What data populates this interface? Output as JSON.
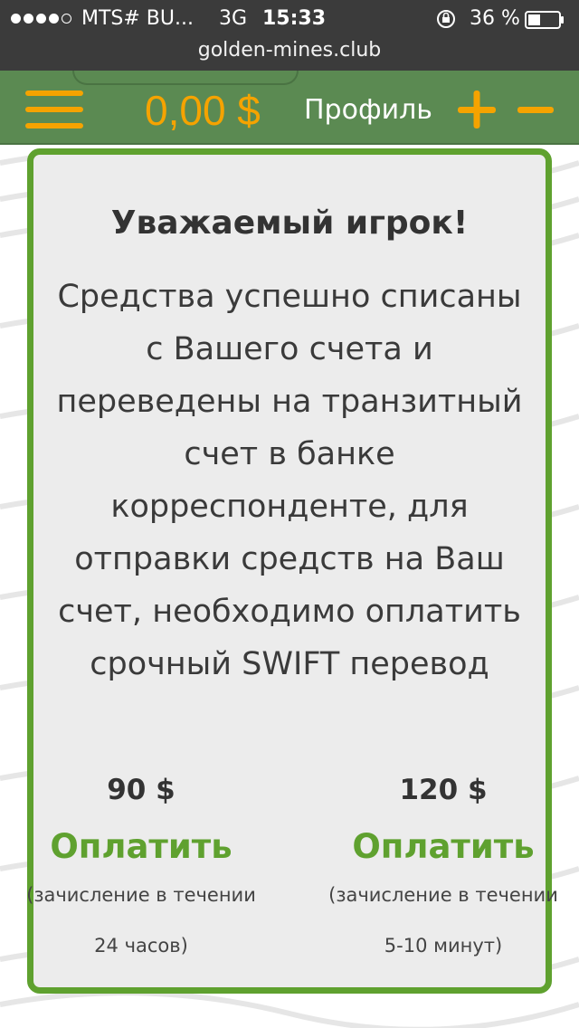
{
  "status_bar": {
    "carrier": "MTS# BU...",
    "network": "3G",
    "time": "15:33",
    "battery": "36 %",
    "url": "golden-mines.club"
  },
  "header": {
    "balance": "0,00 $",
    "profile_label": "Профиль",
    "accent_color": "#f5a300",
    "header_color": "#5b8a52"
  },
  "dialog": {
    "title": "Уважаемый игрок!",
    "message": "Средства успешно списаны с Вашего счета и переведены на транзитный счет в банке корреспонденте, для отправки средств на Ваш счет, необходимо оплатить срочный SWIFT перевод",
    "border_color": "#5fa12f",
    "options": [
      {
        "price": "90 $",
        "button_label": "Оплатить",
        "note_line1": "(зачисление в течении",
        "note_line2": "24 часов)"
      },
      {
        "price": "120 $",
        "button_label": "Оплатить",
        "note_line1": "(зачисление в течении",
        "note_line2": "5-10 минут)"
      }
    ]
  },
  "icons": {
    "menu": "hamburger-icon",
    "plus": "plus-icon",
    "minus": "minus-icon",
    "lock": "rotation-lock-icon",
    "battery": "battery-icon"
  }
}
